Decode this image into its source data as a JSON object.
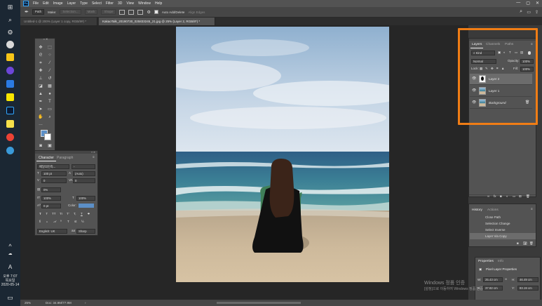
{
  "menubar": {
    "items": [
      "File",
      "Edit",
      "Image",
      "Layer",
      "Type",
      "Select",
      "Filter",
      "3D",
      "View",
      "Window",
      "Help"
    ]
  },
  "options": {
    "mode": "Path",
    "make_label": "Make:",
    "selection": "Selection...",
    "mask": "Mask",
    "shape": "Shape",
    "auto_add_delete": "Auto Add/Delete",
    "align_edges": "Align Edges"
  },
  "tabs": [
    {
      "label": "Untitled-1 @ 200% (Layer 1 copy, RGB/8#) *",
      "active": false
    },
    {
      "label": "KakaoTalk_20190730_025833245_21.jpg @ 25% (Layer 2, RGB/8*) *",
      "active": true
    }
  ],
  "character": {
    "tab_character": "Character",
    "tab_paragraph": "Paragraph",
    "font": "배달의민족...",
    "font_style": "-",
    "size": "100 pt",
    "leading": "(Auto)",
    "kerning": "0",
    "tracking": "0",
    "vscale": "0%",
    "vert": "100%",
    "horiz": "100%",
    "baseline": "0 pt",
    "color_label": "Color:",
    "language": "English: UK",
    "antialias": "Sharp",
    "style_buttons": [
      "T",
      "T",
      "TT",
      "Tr",
      "T'",
      "T,",
      "T",
      "T"
    ]
  },
  "layers": {
    "tab_layers": "Layers",
    "tab_channels": "Channels",
    "tab_paths": "Paths",
    "kind": "Kind",
    "blend": "Normal",
    "opacity_label": "Opacity:",
    "opacity": "100%",
    "lock_label": "Lock:",
    "fill_label": "Fill:",
    "fill": "100%",
    "items": [
      {
        "name": "Layer 2",
        "selected": true
      },
      {
        "name": "Layer 1",
        "selected": false
      },
      {
        "name": "Background",
        "selected": false
      }
    ]
  },
  "history": {
    "tab_history": "History",
    "tab_actions": "Actions",
    "items": [
      "Close Path",
      "Selection Change",
      "Select Inverse",
      "Layer Via Copy"
    ]
  },
  "properties": {
    "tab_properties": "Properties",
    "tab_info": "Info",
    "title": "Pixel Layer Properties",
    "w_label": "W:",
    "w": "25.43 cm",
    "h_label": "H:",
    "h": "46.49 cm",
    "x_label": "X:",
    "x": "37.82 cm",
    "y_label": "Y:",
    "y": "83.19 cm"
  },
  "status": {
    "zoom": "25%",
    "doc": "Doc: 34.9M/77.9M"
  },
  "watermark": {
    "line1": "Windows 정품 인증",
    "line2": "[설정]으로 이동하여 Windows 정품 인증"
  },
  "clock": {
    "time": "오후 7:07",
    "day": "목요일",
    "date": "2020-05-14"
  },
  "accent": {
    "highlight": "#f07d15",
    "ps_blue": "#31a8ff"
  }
}
